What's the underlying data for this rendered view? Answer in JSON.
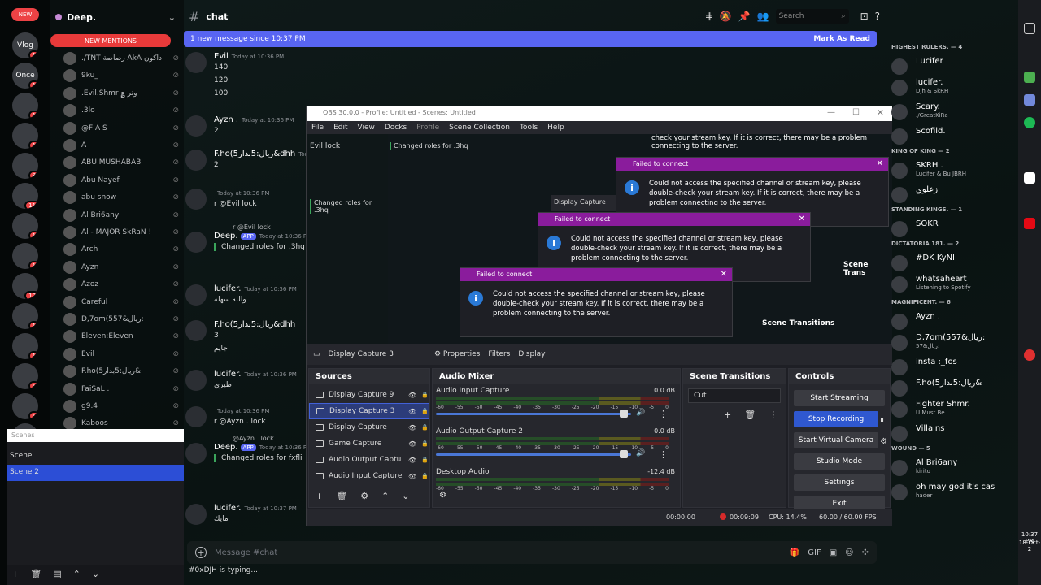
{
  "discord": {
    "server_name": "Deep.",
    "channel": "chat",
    "new_badge": "NEW",
    "search_placeholder": "Search",
    "new_mentions": "NEW MENTIONS",
    "banner_text": "1 new message since 10:37 PM",
    "mark_read": "Mark As Read",
    "composer_placeholder": "Message #chat",
    "typing": "#0xDJH is typing...",
    "servers": [
      {
        "label": "Vlog",
        "badge": "1"
      },
      {
        "label": "Once",
        "badge": "1"
      },
      {
        "label": "",
        "badge": "1"
      },
      {
        "label": "",
        "badge": "1"
      },
      {
        "label": "",
        "badge": "8"
      },
      {
        "label": "",
        "badge": "11"
      },
      {
        "label": "",
        "badge": "1"
      },
      {
        "label": "",
        "badge": "1"
      },
      {
        "label": "",
        "badge": "10"
      },
      {
        "label": "",
        "badge": "1"
      },
      {
        "label": "",
        "badge": "1"
      },
      {
        "label": "",
        "badge": "1"
      },
      {
        "label": "",
        "badge": "1"
      },
      {
        "label": "",
        "badge": ""
      }
    ],
    "dms": [
      "./TNT رصاصة AkA داکون",
      "9ku_",
      ".Evil.Shmr ؏ وتر",
      ".3lo",
      "@F A S",
      "A",
      "ABU MUSHABAB",
      "Abu Nayef",
      "abu snow",
      "Al Bri6any",
      "Al - MAJOR SkRaN !",
      "Arch",
      "Ayzn .",
      "Azoz",
      "Careful",
      "D,7om(5ريال&57:",
      "Eleven:Eleven",
      "Evil",
      "F.ho(5ريال:5بدار&",
      "FaiSaL .",
      "g9.4",
      "Kaboos"
    ],
    "messages": [
      {
        "name": "Evil",
        "time": "Today at 10:36 PM",
        "lines": [
          "140",
          "120",
          "100"
        ]
      },
      {
        "name": "Ayzn .",
        "time": "Today at 10:36 PM",
        "lines": [
          "2"
        ]
      },
      {
        "name": "F.ho(5ريال:5بدار&dhh",
        "time": "Today at 10:36 PM",
        "lines": [
          "2"
        ]
      },
      {
        "name": "",
        "time": "Today at 10:36 PM",
        "lines": [
          "r @Evil lock"
        ]
      },
      {
        "name": "Deep.",
        "app": "APP",
        "time": "Today at 10:36 P",
        "reply": "r @Evil lock",
        "lines": [
          "Changed roles for .3hq"
        ]
      },
      {
        "name": "lucifer.",
        "time": "Today at 10:36 PM",
        "lines": [
          "والله سهله"
        ]
      },
      {
        "name": "F.ho(5ريال:5بدار&dhh",
        "time": "",
        "lines": [
          "3",
          "جايم"
        ]
      },
      {
        "name": "lucifer.",
        "time": "Today at 10:36 PM",
        "lines": [
          "طيري"
        ]
      },
      {
        "name": "",
        "time": "Today at 10:36 PM",
        "lines": [
          "r @Ayzn . lock"
        ]
      },
      {
        "name": "Deep.",
        "app": "APP",
        "time": "Today at 10:36 P",
        "reply": "@Ayzn . lock",
        "lines": [
          "Changed roles for fxfli"
        ]
      },
      {
        "name": "lucifer.",
        "time": "Today at 10:37 PM",
        "lines": [
          "مايك"
        ]
      }
    ],
    "members": [
      {
        "head": "HIGHEST RULERS. — 4"
      },
      {
        "name": "Lucifer",
        "sub": ""
      },
      {
        "name": "lucifer.",
        "sub": "Djh & SkRH"
      },
      {
        "name": "Scary.",
        "sub": "./GreatKiRa"
      },
      {
        "name": "Scofild.",
        "sub": ""
      },
      {
        "head": "KING OF KING — 2"
      },
      {
        "name": "SKRH .",
        "sub": "Lucifer & Bu JBRH"
      },
      {
        "name": "زعلوي",
        "sub": ""
      },
      {
        "head": "STANDING KINGS. — 1"
      },
      {
        "name": "SOKR",
        "sub": ""
      },
      {
        "head": "DICTATORIA 181. — 2"
      },
      {
        "name": "#DK KyNI",
        "sub": ""
      },
      {
        "name": "whatsaheart",
        "sub": "Listening to Spotify"
      },
      {
        "head": "MAGNIFICENT. — 6"
      },
      {
        "name": "Ayzn .",
        "sub": ""
      },
      {
        "name": "D,7om(5ريال&57:",
        "sub": "ريال&57:"
      },
      {
        "name": "insta :_fos",
        "sub": ""
      },
      {
        "name": "F.ho(5ريال:5بدار&",
        "sub": ""
      },
      {
        "name": "Fighter Shmr.",
        "sub": "U Must Be"
      },
      {
        "name": "Villains",
        "sub": ""
      },
      {
        "head": "WOUND — 5"
      },
      {
        "name": "Al Bri6any",
        "sub": "kirito"
      },
      {
        "name": "oh may god it's cas",
        "sub": "hader"
      }
    ]
  },
  "scenes": {
    "header": "Scenes",
    "items": [
      "Scene",
      "Scene 2"
    ]
  },
  "obs": {
    "title": "OBS 30.0.0 - Profile: Untitled - Scenes: Untitled",
    "menu": [
      "File",
      "Edit",
      "View",
      "Docks",
      "Profile",
      "Scene Collection",
      "Tools",
      "Help"
    ],
    "source_bar": "Display Capture 3",
    "properties": "Properties",
    "filters": "Filters",
    "display_label": "Display",
    "sources_title": "Sources",
    "sources": [
      "Display Capture 9",
      "Display Capture 3",
      "Display Capture",
      "Game Capture",
      "Audio Output Captu",
      "Audio Input Capture"
    ],
    "mixer_title": "Audio Mixer",
    "mixer": [
      {
        "name": "Audio Input Capture",
        "db": "0.0 dB"
      },
      {
        "name": "Audio Output Capture 2",
        "db": "0.0 dB"
      },
      {
        "name": "Desktop Audio",
        "db": "-12.4 dB"
      }
    ],
    "ticks": [
      "-60",
      "-55",
      "-50",
      "-45",
      "-40",
      "-35",
      "-30",
      "-25",
      "-20",
      "-15",
      "-10",
      "-5",
      "0"
    ],
    "transitions_title": "Scene Transitions",
    "transition": "Cut",
    "controls_title": "Controls",
    "controls": [
      "Start Streaming",
      "Stop Recording",
      "Start Virtual Camera",
      "Studio Mode",
      "Settings",
      "Exit"
    ],
    "status": {
      "live": "00:00:00",
      "rec": "00:09:09",
      "cpu": "CPU: 14.4%",
      "fps": "60.00 / 60.00 FPS"
    },
    "preview_texts": [
      "Evil lock",
      "Changed roles for .3hq",
      "@Evil lock",
      "Changed roles for .3hq",
      "Display Capture",
      "Sources",
      "Scene Transitions",
      "Scene Trans",
      "Failed to connect"
    ],
    "dialogs": [
      {
        "title": "Failed to connect",
        "text": "Could not access the specified channel or stream key, please double-check your stream key. If it is correct, there may be a problem connecting to the server."
      },
      {
        "title": "Failed to connect",
        "text": "Could not access the specified channel or stream key, please double-check your stream key. If it is correct, there may be a problem connecting to the server."
      },
      {
        "title": "Failed to connect",
        "text": "Could not access the specified channel or stream key, please double-check your stream key. If it is correct, there may be a problem connecting to the server."
      }
    ],
    "bg_text": "check your stream key. If it is correct, there may be a problem connecting to the server."
  },
  "system": {
    "time": "10:37 PM",
    "date": "18-Oct-2"
  }
}
